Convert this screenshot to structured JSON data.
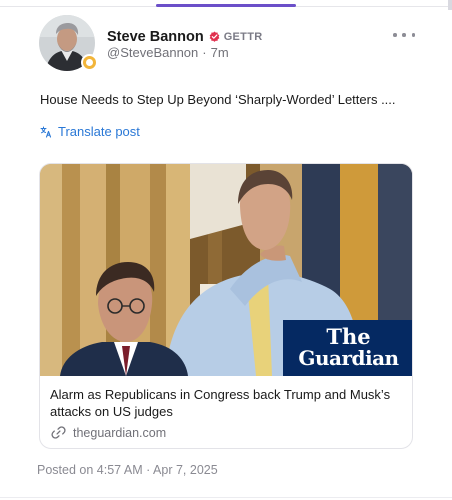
{
  "header": {
    "display_name": "Steve Bannon",
    "platform_tag": "GETTR",
    "handle": "@SteveBannon",
    "separator": "·",
    "time_ago": "7m",
    "avatar": "avatar-photo",
    "badge": "gold-badge-icon",
    "verified": "verified-icon"
  },
  "post": {
    "text": "House Needs to Step Up Beyond ‘Sharply-Worded’ Letters ....",
    "translate_label": "Translate post"
  },
  "link_card": {
    "title": "Alarm as Republicans in Congress back Trump and Musk’s attacks on US judges",
    "domain": "theguardian.com",
    "logo_line1": "The",
    "logo_line2": "Guardian"
  },
  "footer": {
    "posted_label": "Posted on 4:57 AM · Apr 7, 2025"
  },
  "colors": {
    "accent": "#6b4fc9",
    "link": "#2a78d6",
    "verified_red": "#e0304e",
    "guardian_blue": "#052962"
  }
}
